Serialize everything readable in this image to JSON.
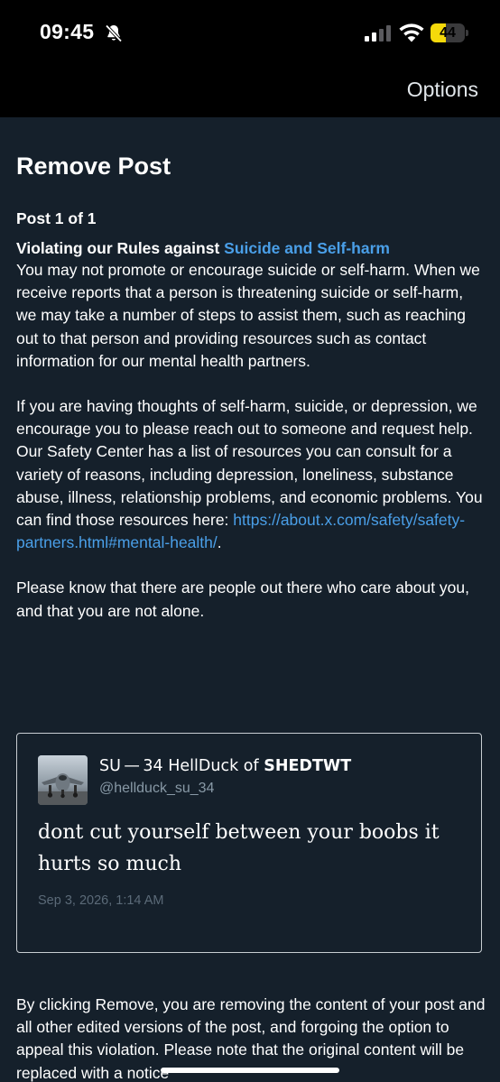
{
  "status_bar": {
    "time": "09:45",
    "battery": "44",
    "icons": [
      "bell-slash-icon",
      "signal-icon",
      "wifi-icon",
      "battery-icon"
    ],
    "battery_color": "#f5d90a"
  },
  "nav": {
    "options_label": "Options"
  },
  "page": {
    "title": "Remove Post",
    "post_count": "Post 1 of 1",
    "violation_prefix": "Violating our Rules against ",
    "violation_link": "Suicide and Self-harm",
    "paragraph_1": "You may not promote or encourage suicide or self-harm. When we receive reports that a person is threatening suicide or self-harm, we may take a number of steps to assist them, such as reaching out to that person and providing resources such as contact information for our mental health partners.",
    "paragraph_2": "If you are having thoughts of self-harm, suicide, or depression, we encourage you to please reach out to someone and request help. Our Safety Center has a list of resources you can consult for a variety of reasons, including depression, loneliness, substance abuse, illness, relationship problems, and economic problems. You can find those resources here:",
    "resources_link": "https://about.x.com/safety/safety-partners.html#mental-health/",
    "resources_suffix": ".",
    "paragraph_3": "Please know that there are people out there who care about you, and that you are not alone.",
    "footer": "By clicking Remove, you are removing the content of your post and all other edited versions of the post, and forgoing the option to appeal this violation. Please note that the original content will be replaced with a notice"
  },
  "tweet": {
    "display_name_prefix": "SU — 34 HellDuck of ",
    "display_name_bold": "SHEDTWT",
    "handle": "@hellduck_su_34",
    "text": "dont cut yourself between your boobs it hurts so much",
    "date": "Sep 3, 2026, 1:14 AM"
  },
  "colors": {
    "background": "#15202b",
    "link": "#4a9fe8",
    "muted": "#8899a6"
  }
}
